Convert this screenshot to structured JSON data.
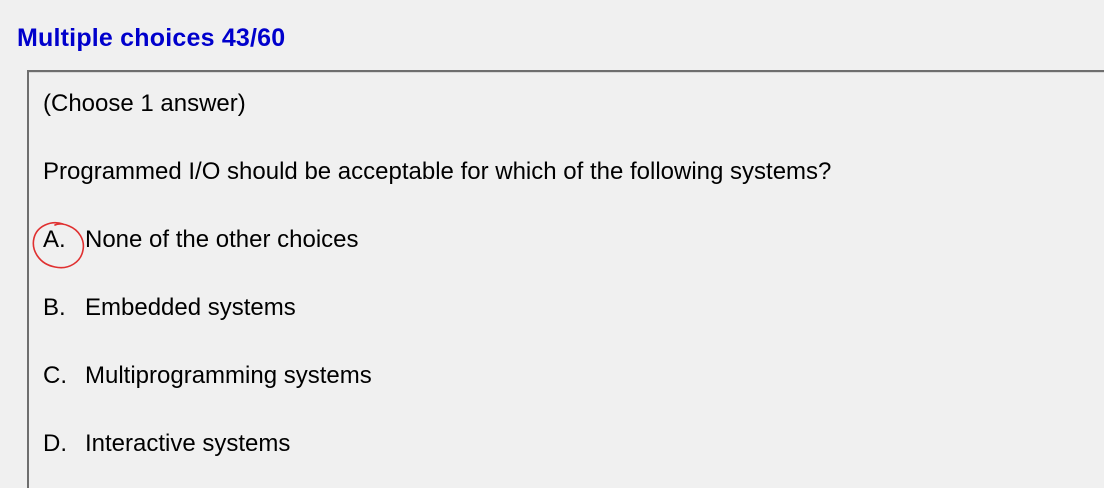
{
  "header": {
    "title": "Multiple choices 43/60"
  },
  "question": {
    "instruction": "(Choose 1 answer)",
    "prompt": "Programmed I/O should be acceptable for which of the following systems?",
    "options": [
      {
        "letter": "A.",
        "text": "None of the other choices",
        "marked": true
      },
      {
        "letter": "B.",
        "text": "Embedded systems",
        "marked": false
      },
      {
        "letter": "C.",
        "text": "Multiprogramming systems",
        "marked": false
      },
      {
        "letter": "D.",
        "text": "Interactive systems",
        "marked": false
      }
    ]
  },
  "colors": {
    "header": "#0000cc",
    "background": "#f0f0f0",
    "marker": "#e03030"
  },
  "icons": {
    "marker": "hand-drawn-circle-icon"
  }
}
